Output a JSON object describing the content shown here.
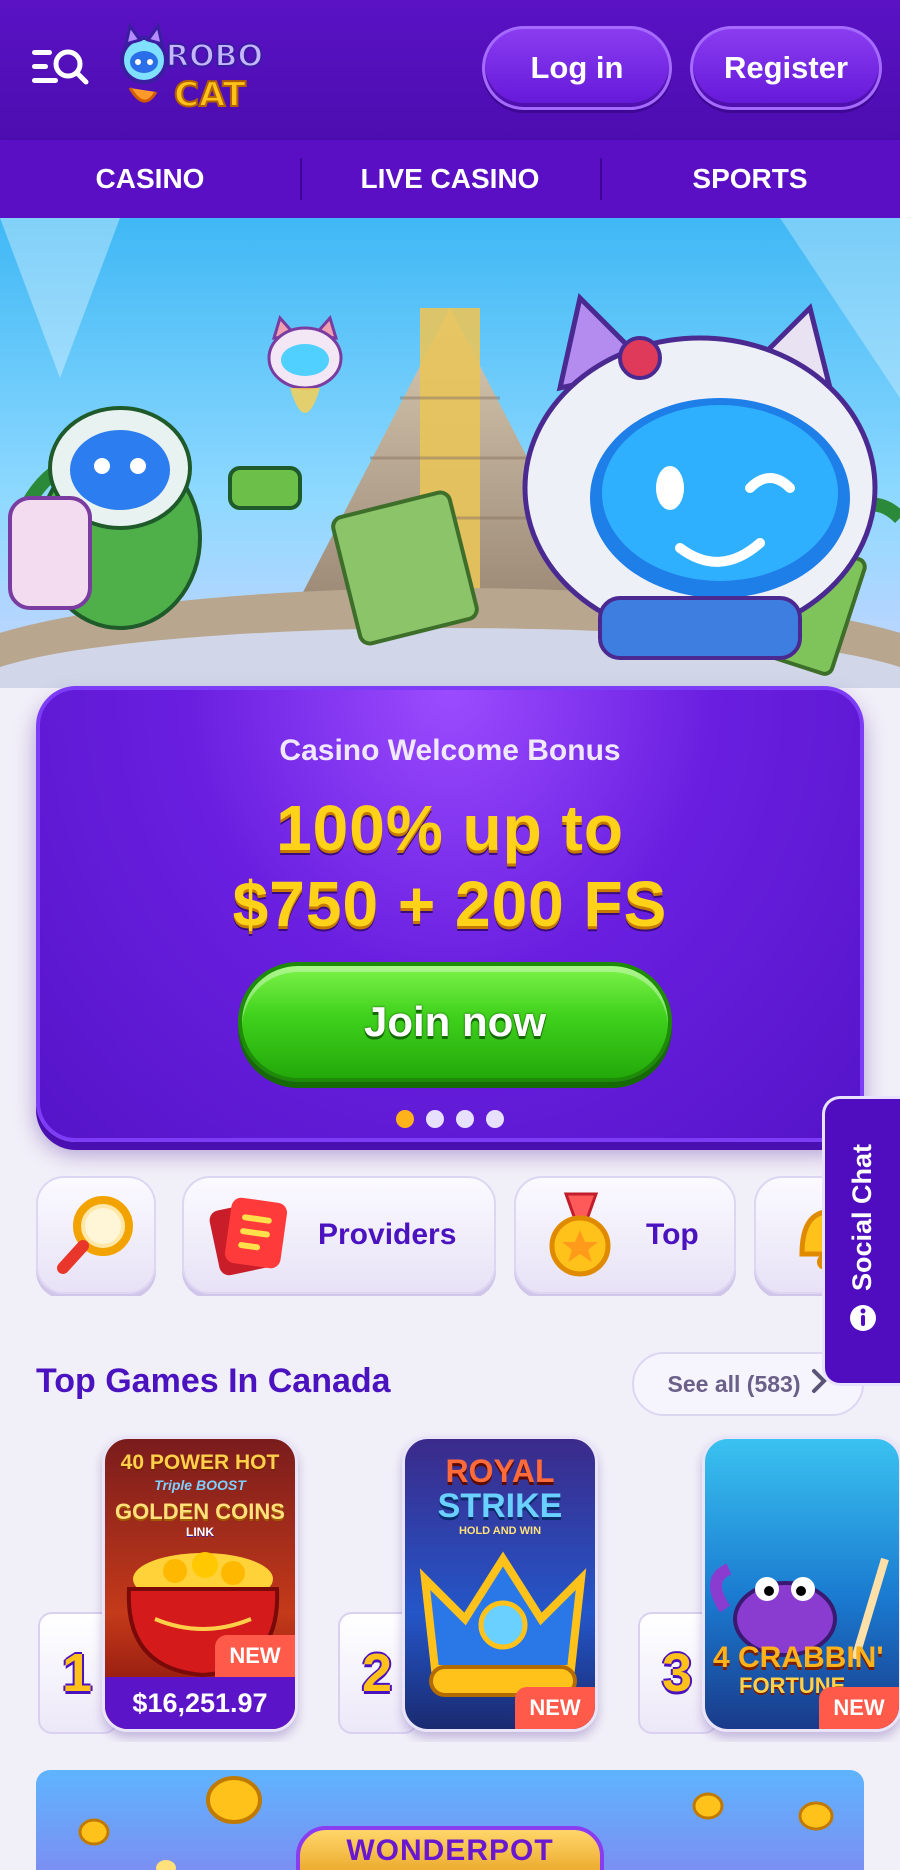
{
  "header": {
    "menu_icon": "menu-search-icon",
    "logo_text_top": "ROBO",
    "logo_text_bottom": "CAT",
    "login_label": "Log in",
    "register_label": "Register"
  },
  "nav": {
    "tabs": [
      {
        "label": "CASINO"
      },
      {
        "label": "LIVE CASINO"
      },
      {
        "label": "SPORTS"
      }
    ]
  },
  "promo": {
    "subtitle": "Casino Welcome Bonus",
    "title_line1": "100% up to",
    "title_line2": "$750 + 200 FS",
    "cta_label": "Join now",
    "slides_total": 4,
    "active_slide": 1
  },
  "social_chat": {
    "label": "Social Chat",
    "icon": "info-icon"
  },
  "categories": [
    {
      "label": "",
      "icon": "search-icon"
    },
    {
      "label": "Providers",
      "icon": "providers-icon"
    },
    {
      "label": "Top",
      "icon": "medal-icon"
    },
    {
      "label": "",
      "icon": "bell-icon"
    }
  ],
  "top_games": {
    "title": "Top Games In Canada",
    "see_all_label": "See all (583)",
    "games": [
      {
        "rank": "1",
        "art_line1": "40 POWER HOT",
        "art_line2": "Triple BOOST",
        "art_line3": "GOLDEN COINS",
        "art_line4": "LINK",
        "badge": "NEW",
        "jackpot": "$16,251.97"
      },
      {
        "rank": "2",
        "art_line1": "ROYAL",
        "art_line2": "STRIKE",
        "art_line3": "HOLD AND WIN",
        "badge": "NEW"
      },
      {
        "rank": "3",
        "art_line1": "4 CRABBIN'",
        "art_line2": "FORTUNE",
        "badge": "NEW"
      }
    ]
  },
  "wonderpot": {
    "label": "WONDERPOT"
  },
  "colors": {
    "brand_purple": "#5a12c4",
    "accent_yellow": "#ffd21a",
    "cta_green": "#3fd11c",
    "new_badge": "#ff5a4a"
  }
}
